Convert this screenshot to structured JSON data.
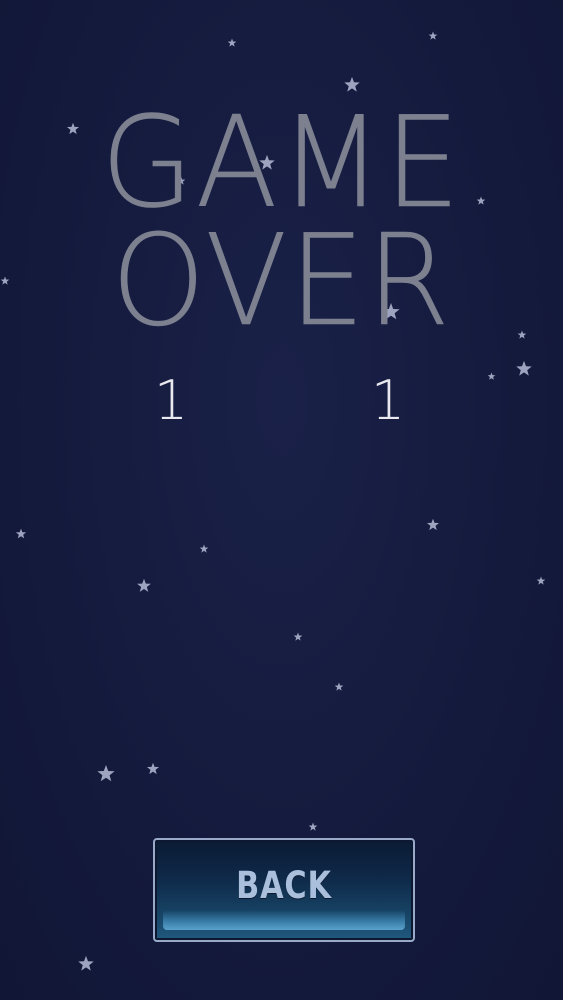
{
  "title": {
    "line1": "GAME",
    "line2": "OVER"
  },
  "scores": {
    "left": "1",
    "right": "1"
  },
  "back_button": {
    "label": "BACK"
  },
  "colors": {
    "background": "#141a3c",
    "title": "#7d818f",
    "score": "#e8e8ee",
    "button_text": "#a9bfdc",
    "star": "#9ea4bf"
  }
}
